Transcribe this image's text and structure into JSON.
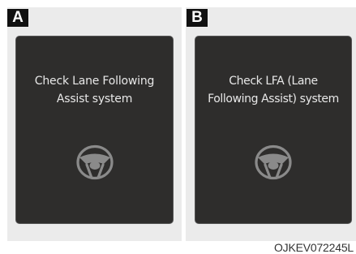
{
  "panels": [
    {
      "badge": "A",
      "message_lines": [
        "Check Lane Following",
        "Assist system"
      ],
      "icon": "steering-wheel-icon"
    },
    {
      "badge": "B",
      "message_lines": [
        "Check LFA (Lane",
        "Following Assist) system"
      ],
      "icon": "steering-wheel-icon"
    }
  ],
  "figure_code": "OJKEV072245L",
  "colors": {
    "screen_background": "#2e2d2c",
    "panel_background": "#ebebeb",
    "badge_background": "#111111",
    "message_text": "#e8e8e8",
    "icon_gray": "#8a8a8a"
  }
}
